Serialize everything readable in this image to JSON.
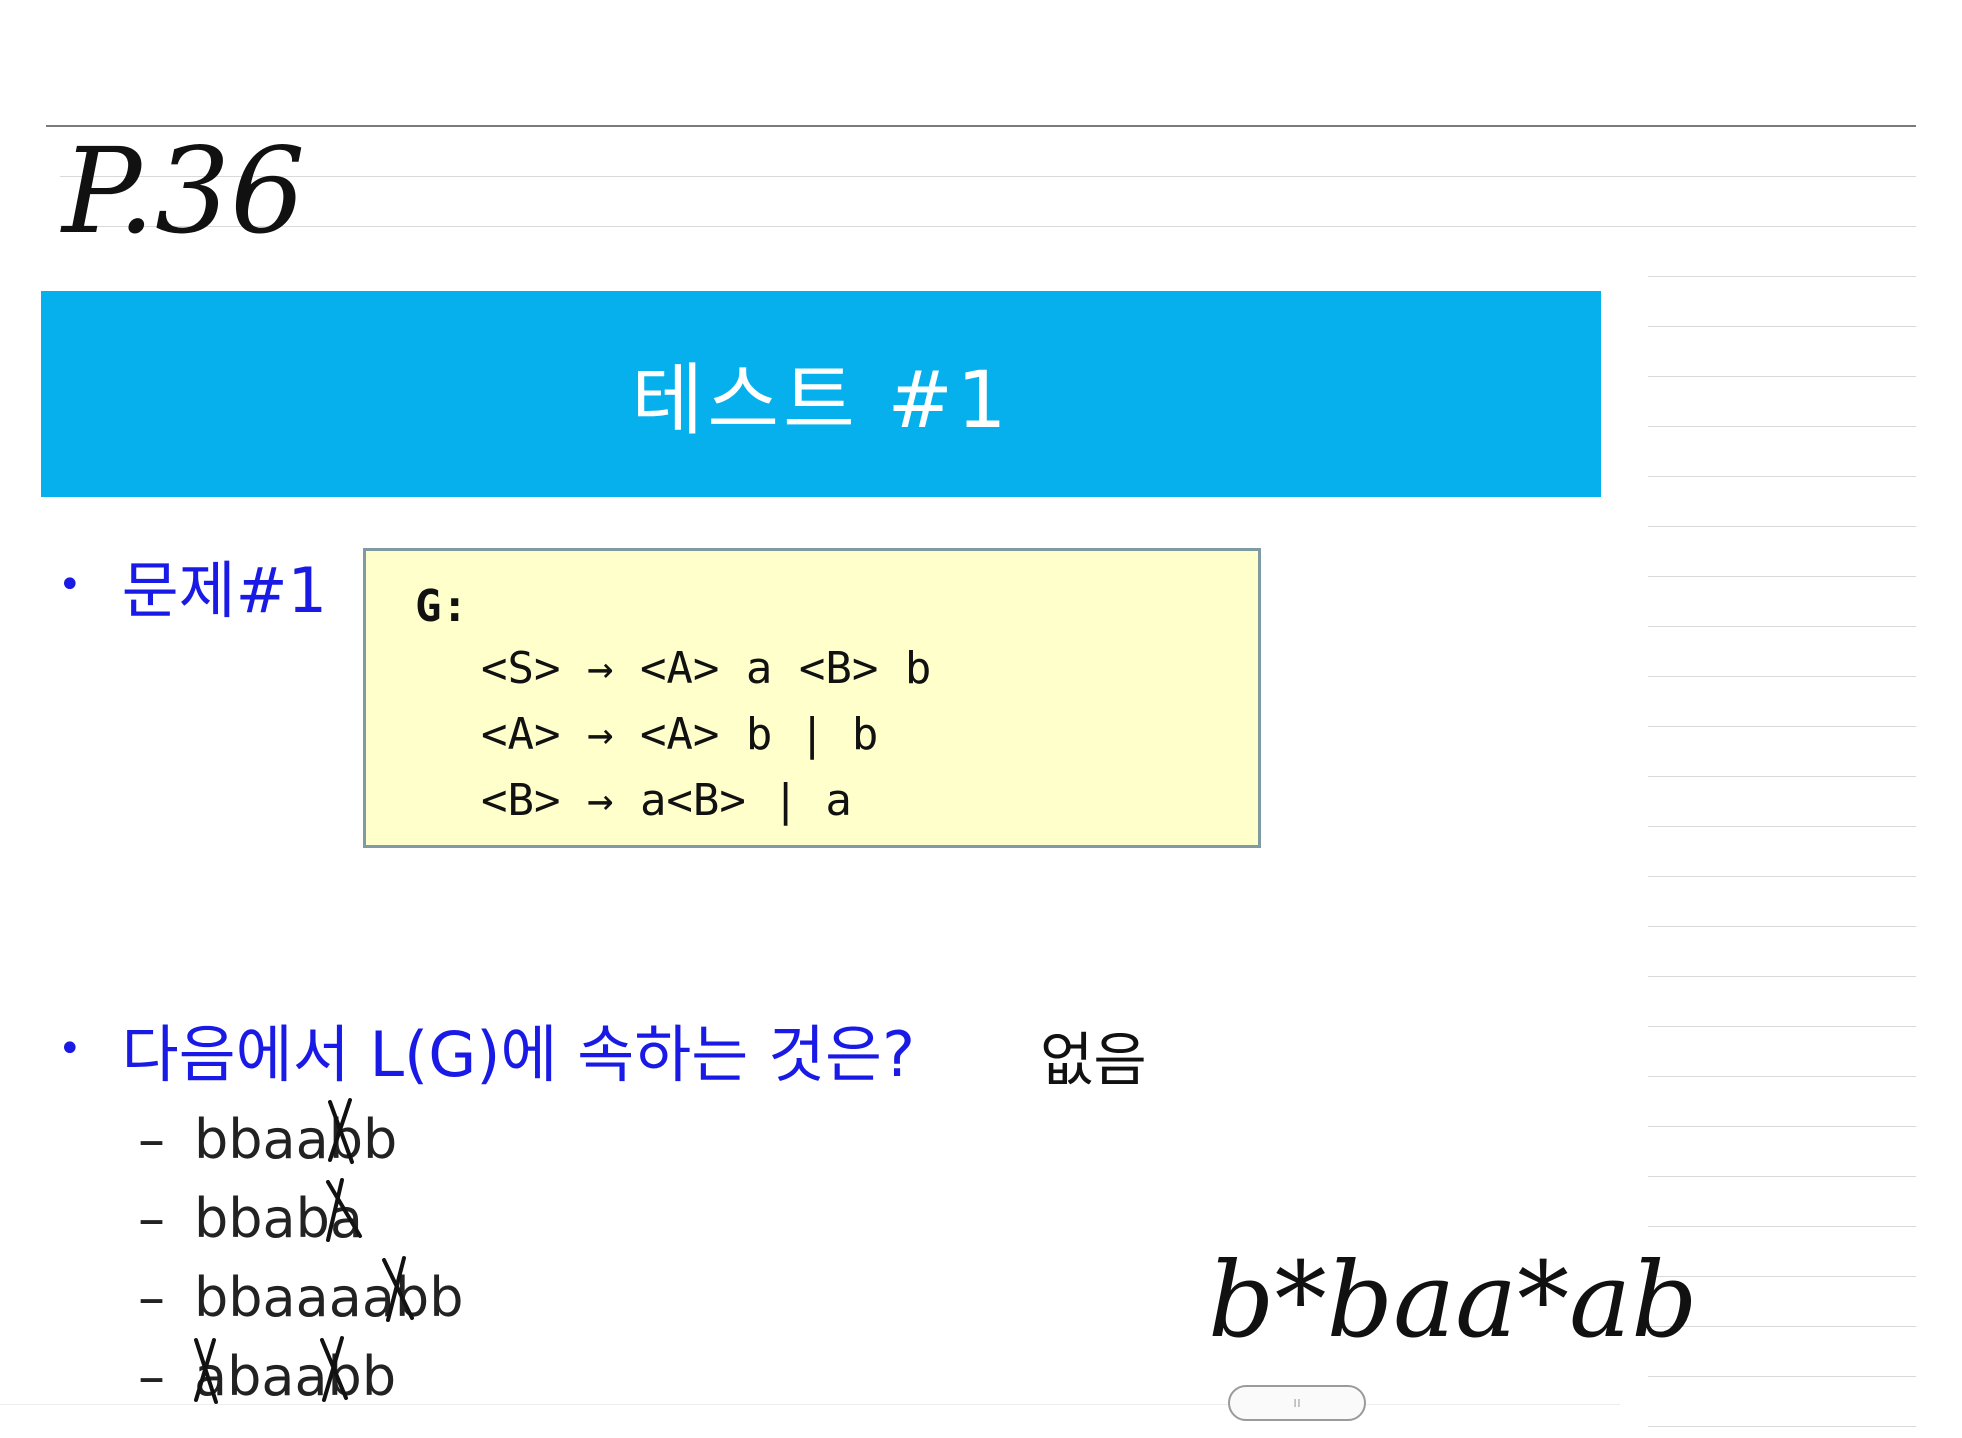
{
  "page_label": "P.36",
  "slide": {
    "title": "테스트 #1",
    "accent_color": "#06b0ec",
    "problem_label": "문제#1",
    "grammar": {
      "label": "G:",
      "rules": [
        "<S> → <A> a <B> b",
        "<A> → <A> b | b",
        "<B> → a<B> | a"
      ]
    },
    "question": "다음에서 L(G)에 속하는 것은?",
    "options": [
      "bbaabb",
      "bbaba",
      "bbaaaabb",
      "abaabb"
    ]
  },
  "annotations": {
    "answer_note": "없음",
    "regex": "b*baa*ab"
  },
  "handle_glyph": "ıı"
}
